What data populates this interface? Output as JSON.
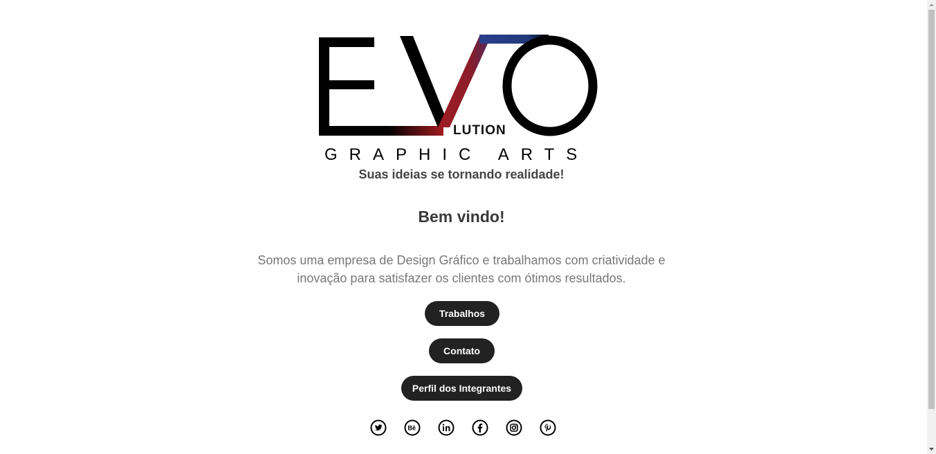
{
  "logo": {
    "wordmark": "EVO",
    "suffix": "LUTION",
    "subtitle": "GRAPHIC ARTS"
  },
  "tagline": "Suas ideias se tornando realidade!",
  "welcome": "Bem vindo!",
  "intro": "Somos uma empresa de Design Gráfico e trabalhamos com criatividade e inovação para satisfazer os clientes com ótimos resultados.",
  "buttons": {
    "trabalhos": "Trabalhos",
    "contato": "Contato",
    "perfil": "Perfil dos Integrantes"
  },
  "social": [
    "twitter-icon",
    "behance-icon",
    "linkedin-icon",
    "facebook-icon",
    "instagram-icon",
    "pinterest-icon"
  ],
  "colors": {
    "button_bg": "#222222",
    "logo_red": "#a01c22",
    "logo_blue": "#1f3a7a",
    "text_dark": "#444444",
    "text_muted": "#777777"
  }
}
